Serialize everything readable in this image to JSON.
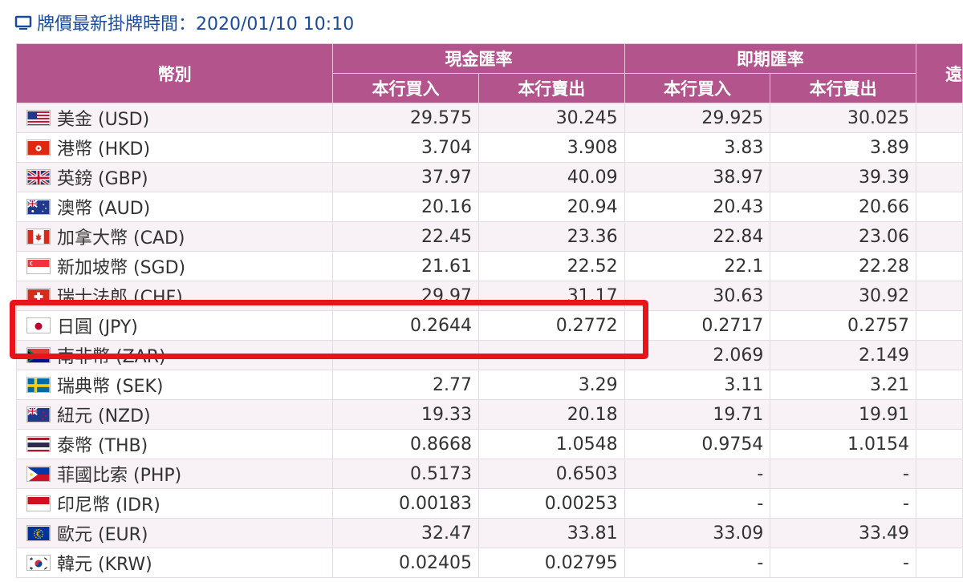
{
  "header": {
    "title": "牌價最新掛牌時間：2020/01/10 10:10"
  },
  "table": {
    "col_currency": "幣別",
    "group_cash": "現金匯率",
    "group_spot": "即期匯率",
    "group_partial": "遠",
    "buy": "本行買入",
    "sell": "本行賣出",
    "rows": [
      {
        "name": "美金 (USD)",
        "flag": "us",
        "cash_buy": "29.575",
        "cash_sell": "30.245",
        "spot_buy": "29.925",
        "spot_sell": "30.025"
      },
      {
        "name": "港幣 (HKD)",
        "flag": "hk",
        "cash_buy": "3.704",
        "cash_sell": "3.908",
        "spot_buy": "3.83",
        "spot_sell": "3.89"
      },
      {
        "name": "英鎊 (GBP)",
        "flag": "gb",
        "cash_buy": "37.97",
        "cash_sell": "40.09",
        "spot_buy": "38.97",
        "spot_sell": "39.39"
      },
      {
        "name": "澳幣 (AUD)",
        "flag": "au",
        "cash_buy": "20.16",
        "cash_sell": "20.94",
        "spot_buy": "20.43",
        "spot_sell": "20.66"
      },
      {
        "name": "加拿大幣 (CAD)",
        "flag": "ca",
        "cash_buy": "22.45",
        "cash_sell": "23.36",
        "spot_buy": "22.84",
        "spot_sell": "23.06"
      },
      {
        "name": "新加坡幣 (SGD)",
        "flag": "sg",
        "cash_buy": "21.61",
        "cash_sell": "22.52",
        "spot_buy": "22.1",
        "spot_sell": "22.28"
      },
      {
        "name": "瑞士法郎 (CHF)",
        "flag": "ch",
        "cash_buy": "29.97",
        "cash_sell": "31.17",
        "spot_buy": "30.63",
        "spot_sell": "30.92"
      },
      {
        "name": "日圓 (JPY)",
        "flag": "jp",
        "cash_buy": "0.2644",
        "cash_sell": "0.2772",
        "spot_buy": "0.2717",
        "spot_sell": "0.2757"
      },
      {
        "name": "南非幣 (ZAR)",
        "flag": "za",
        "cash_buy": "-",
        "cash_sell": "-",
        "spot_buy": "2.069",
        "spot_sell": "2.149"
      },
      {
        "name": "瑞典幣 (SEK)",
        "flag": "se",
        "cash_buy": "2.77",
        "cash_sell": "3.29",
        "spot_buy": "3.11",
        "spot_sell": "3.21"
      },
      {
        "name": "紐元 (NZD)",
        "flag": "nz",
        "cash_buy": "19.33",
        "cash_sell": "20.18",
        "spot_buy": "19.71",
        "spot_sell": "19.91"
      },
      {
        "name": "泰幣 (THB)",
        "flag": "th",
        "cash_buy": "0.8668",
        "cash_sell": "1.0548",
        "spot_buy": "0.9754",
        "spot_sell": "1.0154"
      },
      {
        "name": "菲國比索 (PHP)",
        "flag": "ph",
        "cash_buy": "0.5173",
        "cash_sell": "0.6503",
        "spot_buy": "-",
        "spot_sell": "-"
      },
      {
        "name": "印尼幣 (IDR)",
        "flag": "id",
        "cash_buy": "0.00183",
        "cash_sell": "0.00253",
        "spot_buy": "-",
        "spot_sell": "-"
      },
      {
        "name": "歐元 (EUR)",
        "flag": "eu",
        "cash_buy": "32.47",
        "cash_sell": "33.81",
        "spot_buy": "33.09",
        "spot_sell": "33.49"
      },
      {
        "name": "韓元 (KRW)",
        "flag": "kr",
        "cash_buy": "0.02405",
        "cash_sell": "0.02795",
        "spot_buy": "-",
        "spot_sell": "-"
      }
    ]
  },
  "colors": {
    "header_bg": "#b3548c",
    "highlight": "#e8141b",
    "title_text": "#1a4b9c"
  }
}
